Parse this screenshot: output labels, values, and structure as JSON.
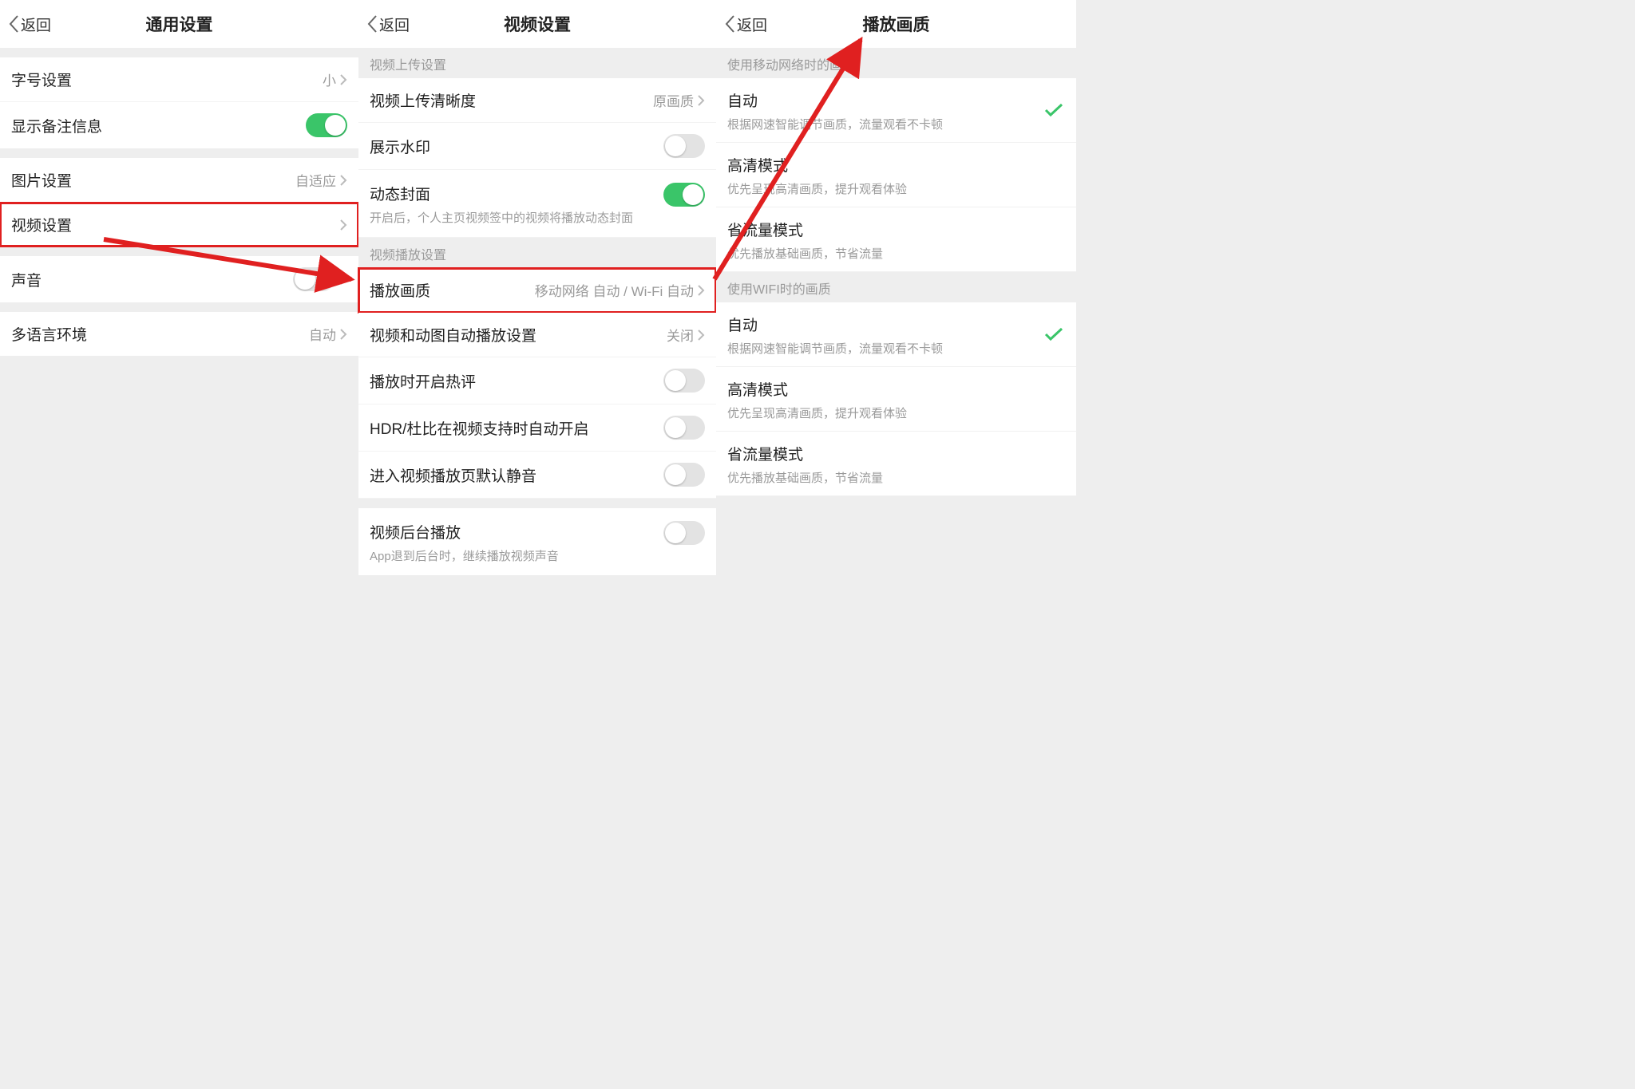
{
  "common": {
    "back_label": "返回"
  },
  "pane1": {
    "title": "通用设置",
    "rows": {
      "font": {
        "label": "字号设置",
        "value": "小"
      },
      "note": {
        "label": "显示备注信息"
      },
      "image": {
        "label": "图片设置",
        "value": "自适应"
      },
      "video": {
        "label": "视频设置"
      },
      "sound": {
        "label": "声音"
      },
      "lang": {
        "label": "多语言环境",
        "value": "自动"
      }
    }
  },
  "pane2": {
    "title": "视频设置",
    "section_upload": "视频上传设置",
    "section_play": "视频播放设置",
    "rows": {
      "upload_q": {
        "label": "视频上传清晰度",
        "value": "原画质"
      },
      "watermark": {
        "label": "展示水印"
      },
      "cover": {
        "label": "动态封面",
        "sub": "开启后，个人主页视频签中的视频将播放动态封面"
      },
      "quality": {
        "label": "播放画质",
        "value": "移动网络 自动 / Wi-Fi 自动"
      },
      "autoplay": {
        "label": "视频和动图自动播放设置",
        "value": "关闭"
      },
      "hot": {
        "label": "播放时开启热评"
      },
      "hdr": {
        "label": "HDR/杜比在视频支持时自动开启"
      },
      "mute": {
        "label": "进入视频播放页默认静音"
      },
      "bg": {
        "label": "视频后台播放",
        "sub": "App退到后台时，继续播放视频声音"
      }
    }
  },
  "pane3": {
    "title": "播放画质",
    "section_mobile": "使用移动网络时的画质",
    "section_wifi": "使用WIFI时的画质",
    "options": {
      "auto": {
        "title": "自动",
        "sub": "根据网速智能调节画质，流量观看不卡顿"
      },
      "hd": {
        "title": "高清模式",
        "sub": "优先呈现高清画质，提升观看体验"
      },
      "save": {
        "title": "省流量模式",
        "sub": "优先播放基础画质，节省流量"
      }
    }
  }
}
